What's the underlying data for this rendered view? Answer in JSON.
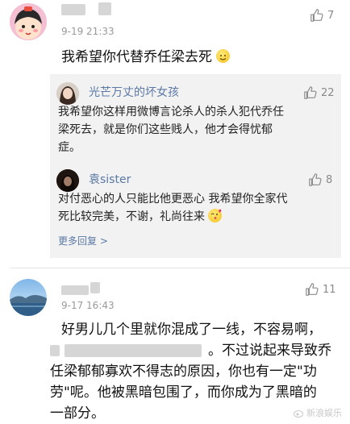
{
  "comments": [
    {
      "time": "9-19 21:33",
      "likes": "7",
      "text": "我希望你代替乔任梁去死",
      "replies": [
        {
          "name": "光芒万丈的坏女孩",
          "likes": "22",
          "text_lines": [
            "我希望你这样用微博言论杀人的杀人犯代乔任",
            "梁死去，就是你们这些贱人，他才会得忧郁",
            "症。"
          ]
        },
        {
          "name": "袁sister",
          "likes": "8",
          "text_lines": [
            "对付恶心的人只能比他更恶心 我希望你全家代",
            "死比较完美，不谢，礼尚往来"
          ]
        }
      ],
      "more_replies": "更多回复 >"
    },
    {
      "time": "9-17 16:43",
      "likes": "11",
      "text_lines": [
        "好男儿几个里就你混成了一线，不容易啊，",
        "。不过说起来导致乔",
        "任梁郁郁寡欢不得志的原因，你也有一定\"功",
        "劳\"呢。他被黑暗包围了，而你成为了黑暗的",
        "一部分。"
      ]
    }
  ],
  "watermark": "新浪娱乐",
  "icons": {
    "like": "thumbs-up-icon",
    "emoji_smile": "smile-emoji-icon",
    "emoji_kiss": "kiss-emoji-icon",
    "watermark_logo": "weibo-logo-icon"
  },
  "colors": {
    "link": "#5b79a5",
    "reply_bg": "#f2f2f2",
    "muted": "#9a9a9a"
  }
}
